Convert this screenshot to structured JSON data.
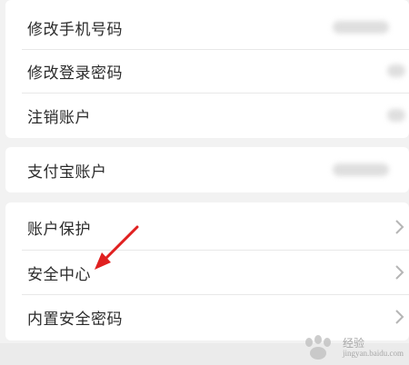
{
  "account_section": {
    "items": [
      {
        "label": "修改手机号码"
      },
      {
        "label": "修改登录密码"
      },
      {
        "label": "注销账户"
      }
    ]
  },
  "alipay_section": {
    "label": "支付宝账户"
  },
  "security_section": {
    "items": [
      {
        "label": "账户保护"
      },
      {
        "label": "安全中心"
      },
      {
        "label": "内置安全密码"
      }
    ]
  },
  "annotation": {
    "arrow_color": "#e02020",
    "points_to": "安全中心"
  },
  "watermark": {
    "brand": "Baidu",
    "text_line1": "经验",
    "text_line2": "jingyan.baidu.com"
  },
  "colors": {
    "background": "#f2f2f2",
    "card": "#ffffff",
    "text": "#2b2b2b",
    "chevron": "#b5b5b5"
  }
}
